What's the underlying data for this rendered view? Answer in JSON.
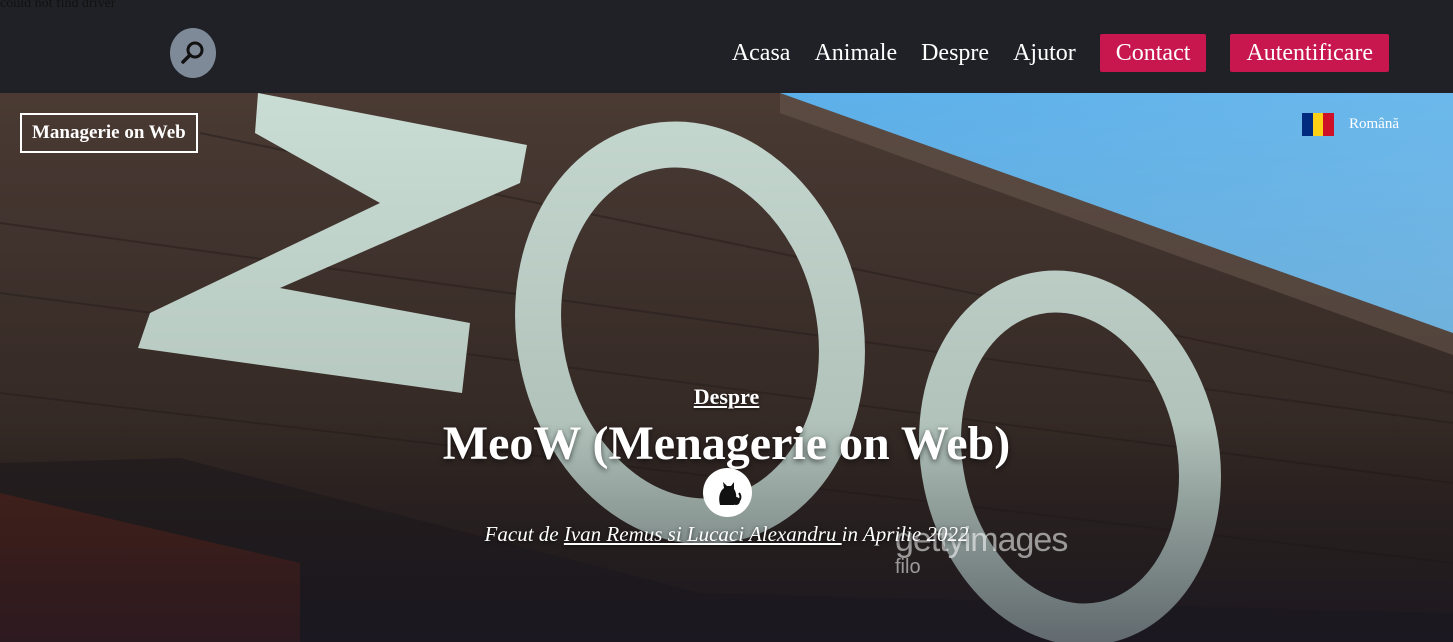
{
  "error_message": "could not find driver",
  "nav": {
    "links": [
      "Acasa",
      "Animale",
      "Despre",
      "Ajutor"
    ],
    "contact_label": "Contact",
    "login_label": "Autentificare",
    "search_icon": "search-icon"
  },
  "hero": {
    "brand": "Managerie on Web",
    "language": "Română",
    "flag_colors": [
      "#002B7F",
      "#FCD116",
      "#CE1126"
    ],
    "section_link": "Despre",
    "title": "MeoW (Menagerie on Web)",
    "logo_icon": "cat-logo-icon",
    "credits_prefix": "Facut de ",
    "credits_authors": "Ivan Remus si Lucaci Alexandru ",
    "credits_suffix": "in Aprilie 2022",
    "watermark": "gettyimages",
    "watermark_sub": "filo"
  },
  "colors": {
    "navbar_bg": "#202127",
    "accent": "#c8174f",
    "search_bg": "#7f8a99"
  }
}
